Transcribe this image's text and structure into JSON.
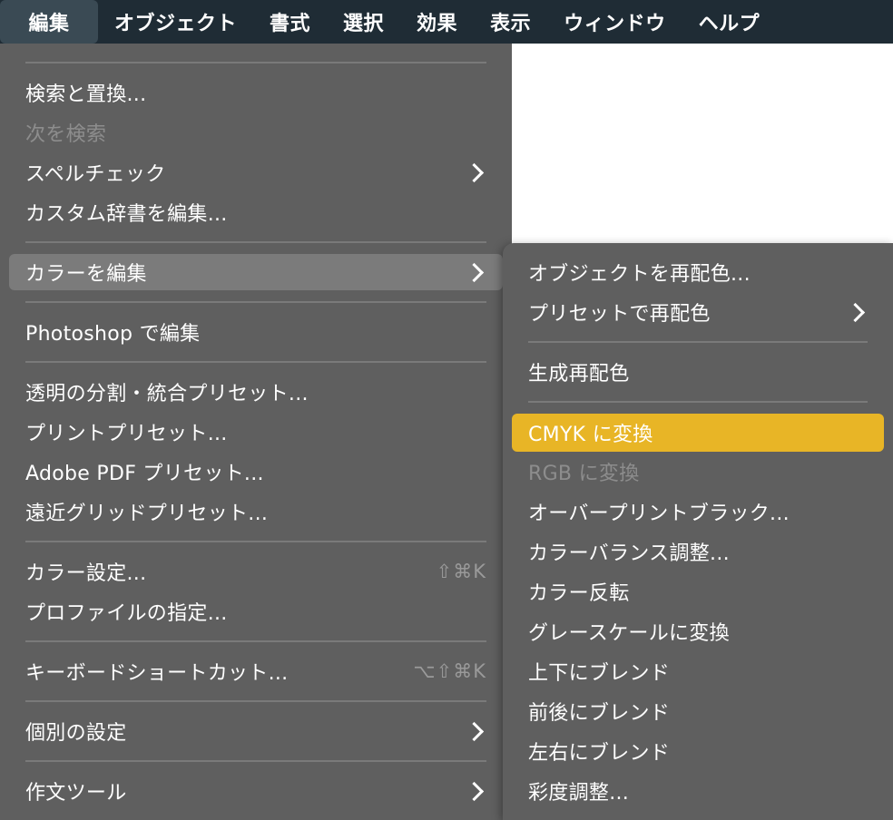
{
  "menubar": {
    "items": [
      "編集",
      "オブジェクト",
      "書式",
      "選択",
      "効果",
      "表示",
      "ウィンドウ",
      "ヘルプ"
    ]
  },
  "edit_menu": {
    "find_replace": "検索と置換...",
    "find_next": "次を検索",
    "spell_check": "スペルチェック",
    "custom_dict": "カスタム辞書を編集...",
    "edit_colors": "カラーを編集",
    "edit_photoshop": "Photoshop で編集",
    "transparency_preset": "透明の分割・統合プリセット...",
    "print_preset": "プリントプリセット...",
    "pdf_preset": "Adobe PDF プリセット...",
    "perspective_grid_preset": "遠近グリッドプリセット...",
    "color_settings": "カラー設定...",
    "color_settings_shortcut": "⇧⌘K",
    "assign_profile": "プロファイルの指定...",
    "keyboard_shortcuts": "キーボードショートカット...",
    "keyboard_shortcuts_shortcut": "⌥⇧⌘K",
    "preferences": "個別の設定",
    "writing_tools": "作文ツール"
  },
  "color_submenu": {
    "recolor_artwork": "オブジェクトを再配色...",
    "recolor_preset": "プリセットで再配色",
    "generative_recolor": "生成再配色",
    "convert_cmyk": "CMYK に変換",
    "convert_rgb": "RGB に変換",
    "overprint_black": "オーバープリントブラック...",
    "adjust_balance": "カラーバランス調整...",
    "invert_colors": "カラー反転",
    "convert_grayscale": "グレースケールに変換",
    "blend_vertical": "上下にブレンド",
    "blend_front_back": "前後にブレンド",
    "blend_horizontal": "左右にブレンド",
    "saturate": "彩度調整..."
  }
}
